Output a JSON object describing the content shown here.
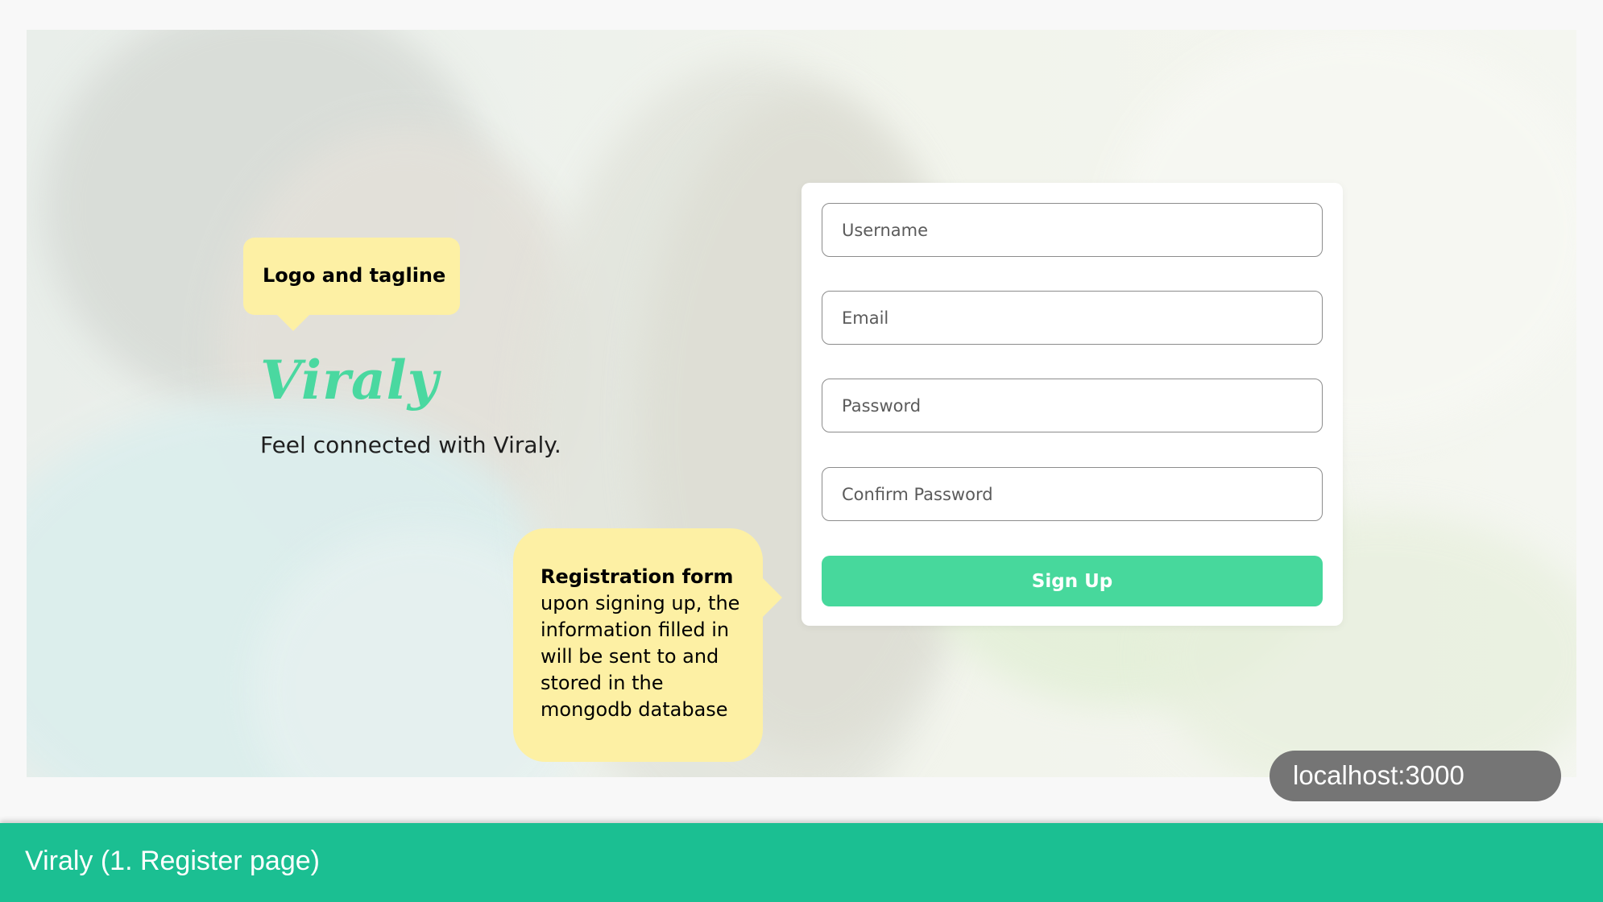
{
  "brand": {
    "logo_text": "Viraly",
    "tagline": "Feel connected with Viraly.",
    "logo_color": "#4ad8a0"
  },
  "annotations": {
    "logo": "Logo and tagline",
    "form_title": "Registration form",
    "form_body": "upon signing up, the information filled in will be sent to and stored in the mongodb database"
  },
  "form": {
    "fields": [
      {
        "placeholder": "Username",
        "value": ""
      },
      {
        "placeholder": "Email",
        "value": ""
      },
      {
        "placeholder": "Password",
        "value": ""
      },
      {
        "placeholder": "Confirm Password",
        "value": ""
      }
    ],
    "submit_label": "Sign Up",
    "accent_color": "#47d89c"
  },
  "url_label": "localhost:3000",
  "caption": "Viraly (1. Register page)",
  "colors": {
    "caption_bar": "#1bbf92",
    "callout": "#fdf0a4",
    "url_pill": "#757575"
  }
}
